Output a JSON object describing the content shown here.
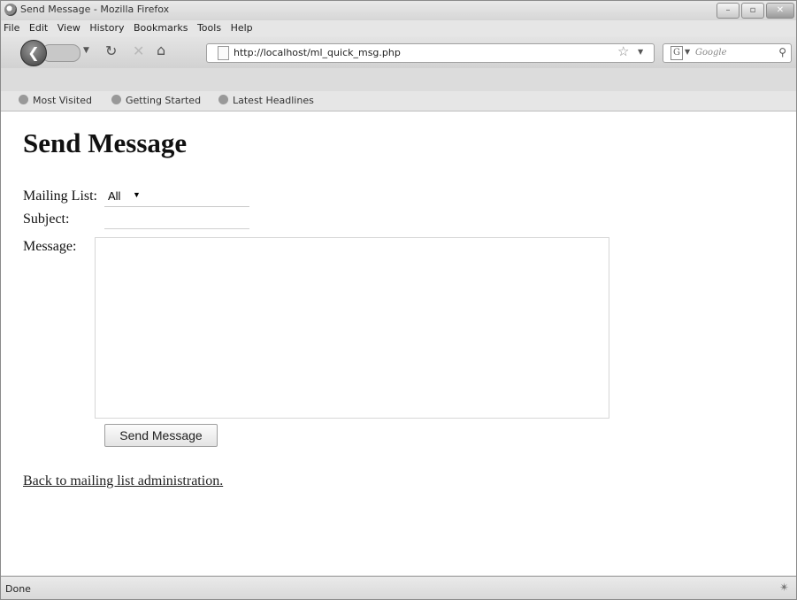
{
  "window": {
    "title": "Send Message - Mozilla Firefox",
    "buttons": [
      "–",
      "▫",
      "✕"
    ]
  },
  "menubar": [
    "File",
    "Edit",
    "View",
    "History",
    "Bookmarks",
    "Tools",
    "Help"
  ],
  "navbar": {
    "url": "http://localhost/ml_quick_msg.php",
    "search_placeholder": "Google",
    "search_engine_glyph": "G"
  },
  "bookmarks": [
    "Most Visited",
    "Getting Started",
    "Latest Headlines"
  ],
  "page": {
    "heading": "Send Message",
    "mailing_list_label": "Mailing List:",
    "mailing_list_value": "All",
    "subject_label": "Subject:",
    "subject_value": "",
    "message_label": "Message:",
    "message_value": "",
    "send_button": "Send Message",
    "back_link": "Back to mailing list administration."
  },
  "status": {
    "text": "Done"
  },
  "icons": {
    "back": "back-arrow-icon",
    "forward": "forward-arrow-icon",
    "reload": "reload-icon",
    "stop": "stop-icon",
    "home": "home-icon",
    "star": "star-icon",
    "search": "search-icon"
  }
}
